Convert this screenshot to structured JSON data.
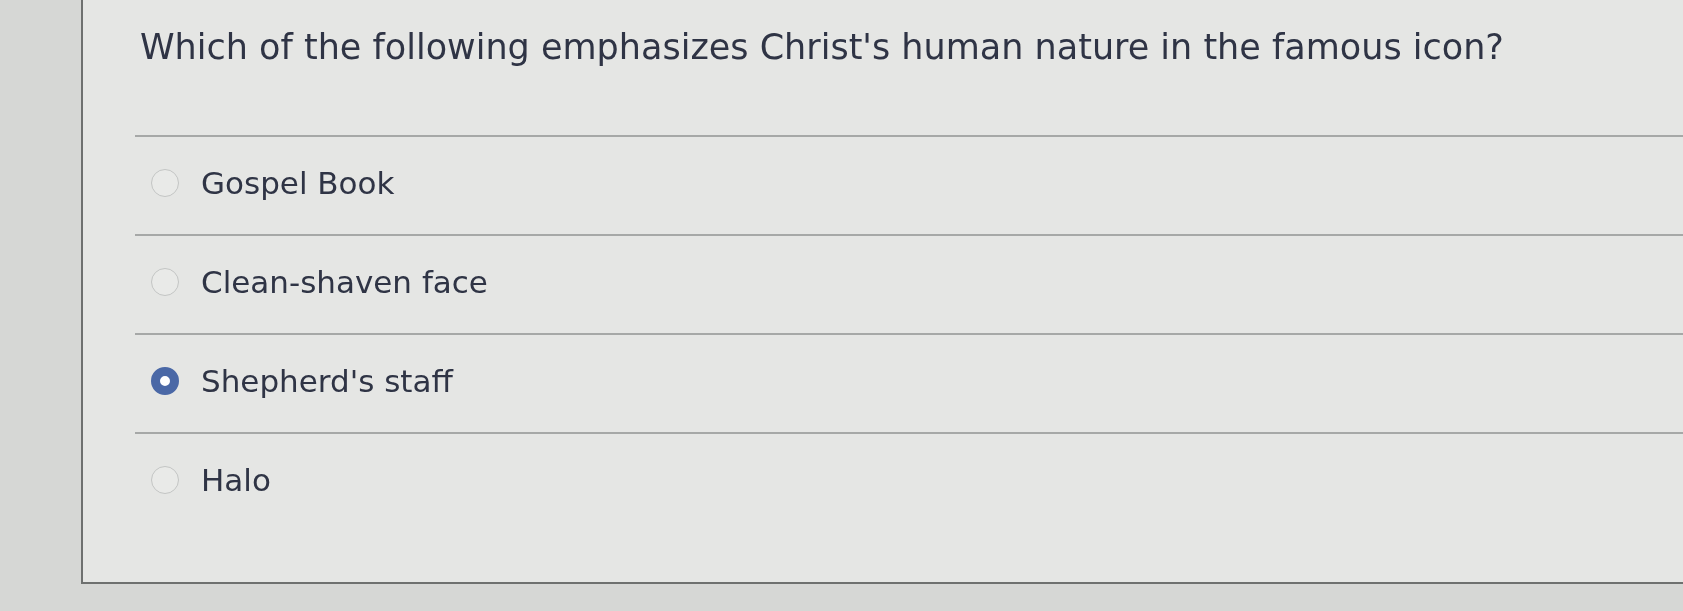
{
  "question": {
    "text": "Which of the following emphasizes Christ's human nature in the famous icon?"
  },
  "options": [
    {
      "label": "Gospel Book",
      "selected": false
    },
    {
      "label": "Clean-shaven face",
      "selected": false
    },
    {
      "label": "Shepherd's staff",
      "selected": true
    },
    {
      "label": "Halo",
      "selected": false
    }
  ]
}
